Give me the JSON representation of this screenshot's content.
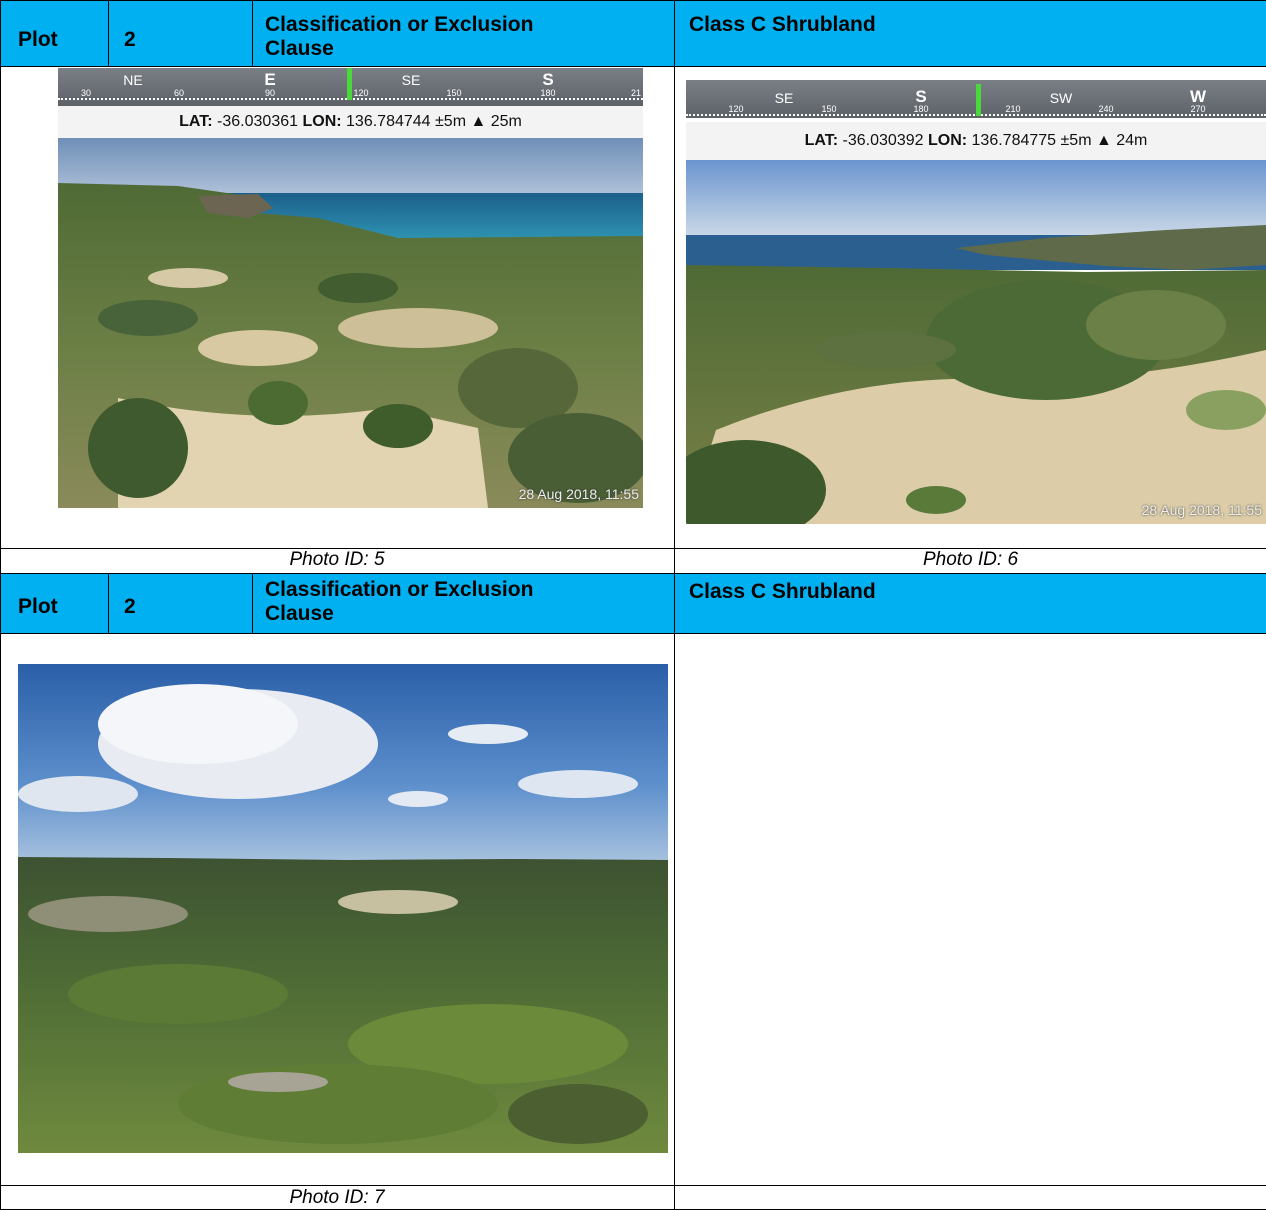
{
  "header_row_1": {
    "plot_label": "Plot",
    "plot_value": "2",
    "clause_label_line1": "Classification or Exclusion",
    "clause_label_line2": "Clause",
    "clause_value": "Class C Shrubland"
  },
  "photo_5": {
    "compass": {
      "dirs": [
        "NE",
        "E",
        "SE",
        "S"
      ],
      "degrees": [
        "30",
        "60",
        "90",
        "120",
        "150",
        "180",
        "21"
      ]
    },
    "gps_lat_label": "LAT:",
    "gps_lat": "-36.030361",
    "gps_lon_label": "LON:",
    "gps_lon": "136.784744 ±5m",
    "gps_alt": "▲ 25m",
    "timestamp": "28 Aug 2018, 11:55",
    "caption": "Photo ID: 5"
  },
  "photo_6": {
    "compass": {
      "dirs": [
        "SE",
        "S",
        "SW",
        "W"
      ],
      "degrees": [
        "120",
        "150",
        "180",
        "210",
        "240",
        "270"
      ]
    },
    "gps_lat_label": "LAT:",
    "gps_lat": "-36.030392",
    "gps_lon_label": "LON:",
    "gps_lon": "136.784775 ±5m",
    "gps_alt": "▲ 24m",
    "timestamp": "28 Aug 2018, 11:55",
    "caption": "Photo ID: 6"
  },
  "header_row_2": {
    "plot_label": "Plot",
    "plot_value": "2",
    "clause_label_line1": "Classification or Exclusion",
    "clause_label_line2": "Clause",
    "clause_value": "Class C Shrubland"
  },
  "photo_7": {
    "caption": "Photo ID: 7"
  },
  "colors": {
    "header_bg": "#00b0f0",
    "border": "#000000"
  }
}
